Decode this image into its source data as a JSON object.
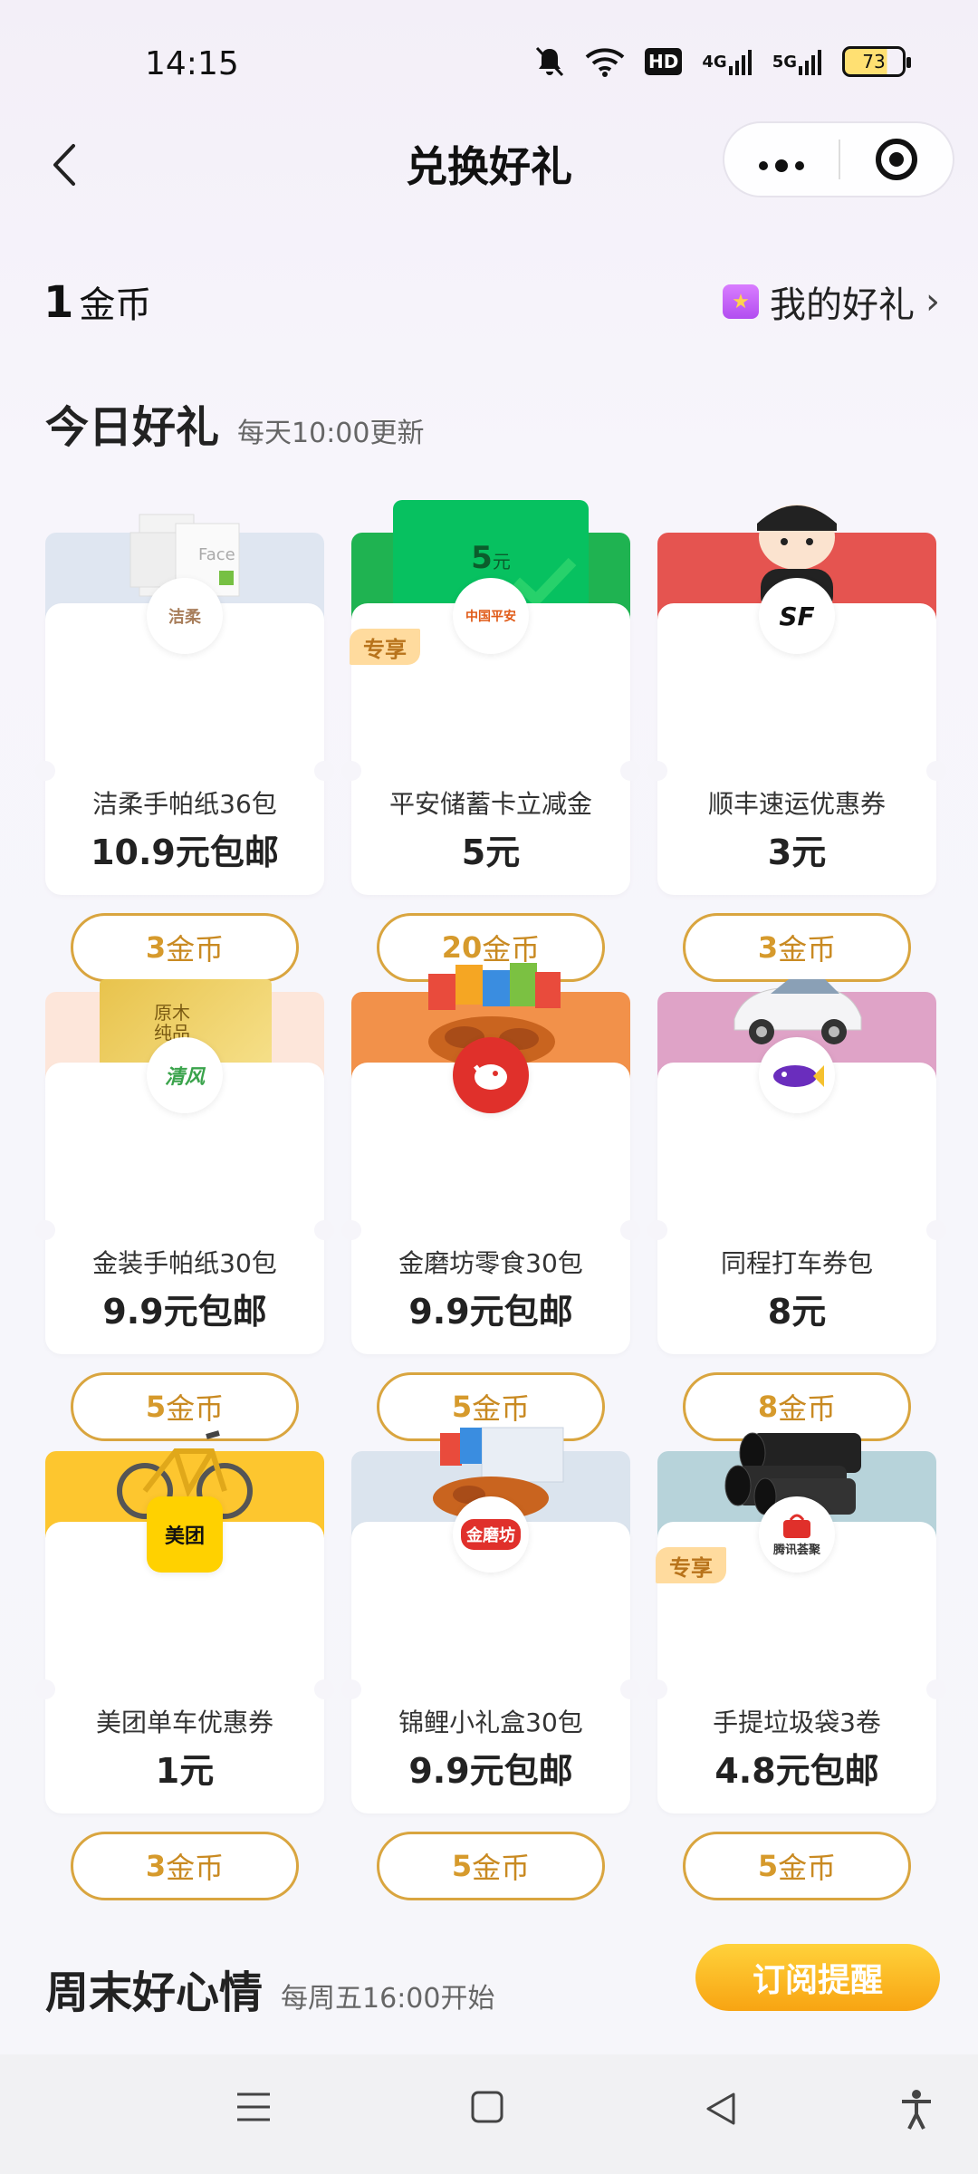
{
  "status": {
    "time": "14:15",
    "hd": "HD",
    "net1": "4G",
    "net2": "5G",
    "battery": "73"
  },
  "nav": {
    "title": "兑换好礼",
    "back": "‹",
    "more": "•••"
  },
  "coins": {
    "count": "1",
    "unit": "金币",
    "my_gifts": "我的好礼",
    "chevron": "›"
  },
  "today": {
    "title": "今日好礼",
    "subtitle": "每天10:00更新"
  },
  "exclusive_label": "专享",
  "cards": [
    {
      "name": "洁柔手帕纸36包",
      "price": "10.9元包邮",
      "cost": "3",
      "unit": "金币",
      "logo": "洁柔",
      "band": "#dfe6f1",
      "logo_color": "#a87e5b"
    },
    {
      "name": "平安储蓄卡立减金",
      "price": "5元",
      "cost": "20",
      "unit": "金币",
      "logo": "中国平安",
      "band": "#1fb351",
      "logo_color": "#e05a17",
      "card_value": "5",
      "card_unit": "元"
    },
    {
      "name": "顺丰速运优惠券",
      "price": "3元",
      "cost": "3",
      "unit": "金币",
      "logo": "SF",
      "band": "#e55450",
      "logo_color": "#111"
    },
    {
      "name": "金装手帕纸30包",
      "price": "9.9元包邮",
      "cost": "5",
      "unit": "金币",
      "logo": "清风",
      "band": "#fde6da",
      "logo_color": "#3aa34b",
      "pkg_text": "原木纯品"
    },
    {
      "name": "金磨坊零食30包",
      "price": "9.9元包邮",
      "cost": "5",
      "unit": "金币",
      "logo": "JD",
      "band": "#f2914a",
      "logo_color": "#e0302b"
    },
    {
      "name": "同程打车券包",
      "price": "8元",
      "cost": "8",
      "unit": "金币",
      "logo": "同程",
      "band": "#dfa3c7",
      "logo_color": "#6a2dbd"
    },
    {
      "name": "美团单车优惠券",
      "price": "1元",
      "cost": "3",
      "unit": "金币",
      "logo": "美团",
      "band": "#fdc62f",
      "logo_color": "#111"
    },
    {
      "name": "锦鲤小礼盒30包",
      "price": "9.9元包邮",
      "cost": "5",
      "unit": "金币",
      "logo": "金磨坊",
      "band": "#dbe4ee",
      "logo_color": "#e0302b"
    },
    {
      "name": "手提垃圾袋3卷",
      "price": "4.8元包邮",
      "cost": "5",
      "unit": "金币",
      "logo": "腾讯荟聚",
      "band": "#b7d3da",
      "logo_color": "#e0302b"
    }
  ],
  "weekend": {
    "title": "周末好心情",
    "subtitle": "每周五16:00开始",
    "subscribe": "订阅提醒"
  }
}
